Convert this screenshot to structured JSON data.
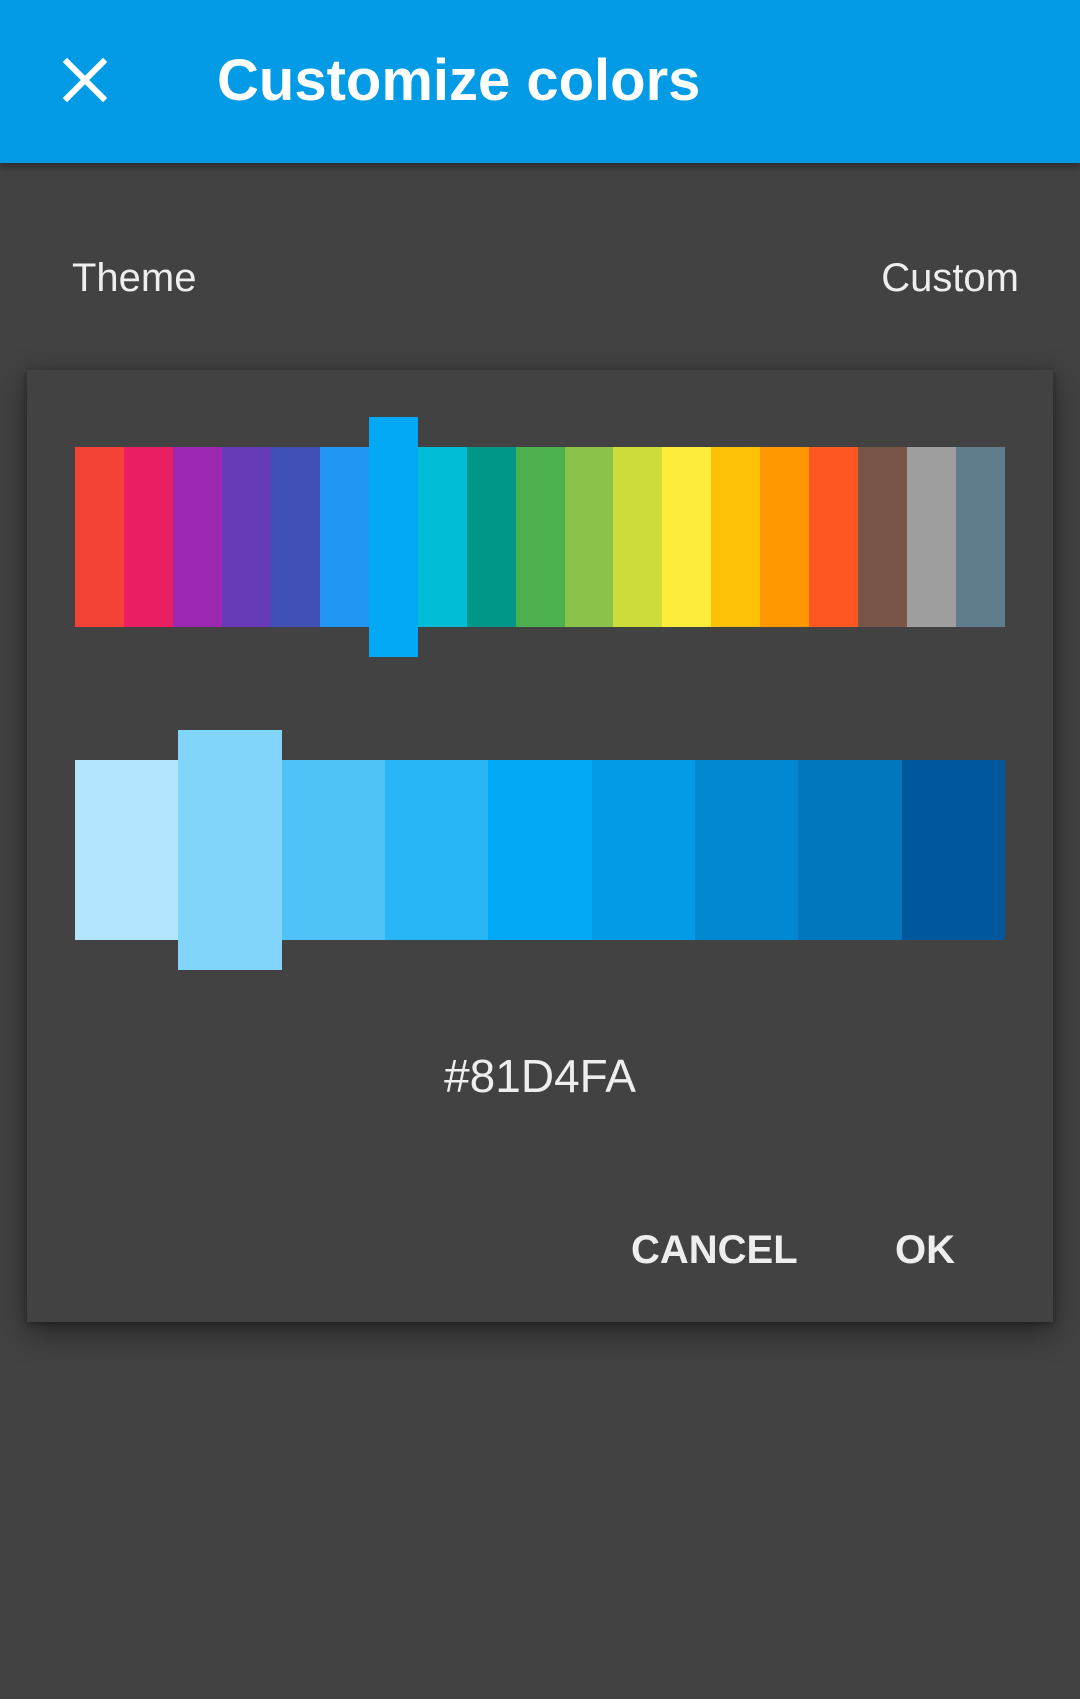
{
  "app_bar": {
    "title": "Customize colors",
    "close_icon": "close-icon",
    "background": "#039BE5"
  },
  "theme": {
    "label": "Theme",
    "value": "Custom"
  },
  "dialog": {
    "primary_colors": [
      "#F44336",
      "#E91E63",
      "#9C27B0",
      "#673AB7",
      "#3F51B5",
      "#2196F3",
      "#03A9F4",
      "#00BCD4",
      "#009688",
      "#4CAF50",
      "#8BC34A",
      "#CDDC39",
      "#FFEB3B",
      "#FFC107",
      "#FF9800",
      "#FF5722",
      "#795548",
      "#9E9E9E",
      "#607D8B"
    ],
    "primary_selected_index": 6,
    "shade_colors": [
      "#B3E5FC",
      "#81D4FA",
      "#4FC3F7",
      "#29B6F6",
      "#03A9F4",
      "#039BE5",
      "#0288D1",
      "#0277BD",
      "#01579B"
    ],
    "shade_selected_index": 1,
    "hex": "#81D4FA",
    "cancel_label": "CANCEL",
    "ok_label": "OK"
  }
}
